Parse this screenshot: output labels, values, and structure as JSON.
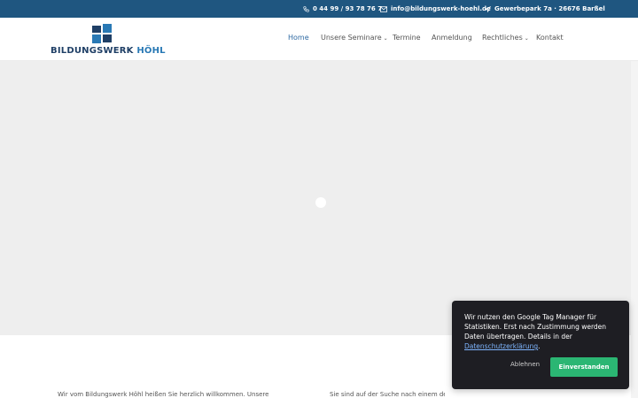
{
  "topbar": {
    "phone": "0 44 99 / 93 78 76 7",
    "email": "info@bildungswerk-hoehl.de",
    "address": "Gewerbepark 7a · 26676 Barßel"
  },
  "logo": {
    "word1": "BILDUNGSWERK",
    "word2": "HÖHL",
    "colors": {
      "dark": "#1f3f66",
      "light": "#2979b5"
    }
  },
  "nav": {
    "items": [
      {
        "label": "Home",
        "active": true
      },
      {
        "label": "Unsere Seminare",
        "dropdown": true
      },
      {
        "label": "Termine"
      },
      {
        "label": "Anmeldung"
      },
      {
        "label": "Rechtliches",
        "dropdown": true
      },
      {
        "label": "Kontakt"
      }
    ]
  },
  "bottom": {
    "left": "Wir vom Bildungswerk Höhl heißen Sie herzlich willkommen. Unsere",
    "right": "Sie sind auf der Suche nach einem der Bereiche Lehrgang ber..."
  },
  "cookie": {
    "message": "Wir nutzen den Google Tag Manager für Statistiken. Erst nach Zustimmung werden Daten übertragen. Details in der",
    "link": "Datenschutzerklärung",
    "period": ".",
    "decline": "Ablehnen",
    "accept": "Einverstanden"
  },
  "colors": {
    "topbar": "#1f5680",
    "accent": "#2f6aa3",
    "accept": "#2bb673",
    "hero_placeholder": "#eeeeee"
  }
}
